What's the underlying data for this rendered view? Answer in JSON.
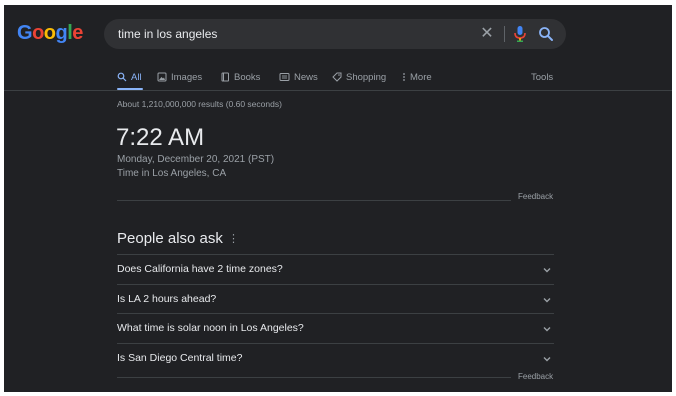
{
  "logo": {
    "text": "Google",
    "letters": [
      {
        "ch": "G",
        "color": "#4285f4"
      },
      {
        "ch": "o",
        "color": "#ea4335"
      },
      {
        "ch": "o",
        "color": "#fbbc05"
      },
      {
        "ch": "g",
        "color": "#4285f4"
      },
      {
        "ch": "l",
        "color": "#34a853"
      },
      {
        "ch": "e",
        "color": "#ea4335"
      }
    ]
  },
  "search": {
    "query": "time in los angeles",
    "clear_icon": "close-icon",
    "mic_icon": "mic-icon",
    "search_icon": "search-icon"
  },
  "tabs": [
    {
      "label": "All",
      "icon": "search-icon",
      "active": true
    },
    {
      "label": "Images",
      "icon": "image-icon",
      "active": false
    },
    {
      "label": "Books",
      "icon": "book-icon",
      "active": false
    },
    {
      "label": "News",
      "icon": "news-icon",
      "active": false
    },
    {
      "label": "Shopping",
      "icon": "tag-icon",
      "active": false
    },
    {
      "label": "More",
      "icon": "more-vert-icon",
      "active": false
    }
  ],
  "tools_label": "Tools",
  "result_stats": "About 1,210,000,000 results (0.60 seconds)",
  "time_card": {
    "time": "7:22 AM",
    "date": "Monday, December 20, 2021 (PST)",
    "location": "Time in Los Angeles, CA",
    "feedback": "Feedback"
  },
  "people_also_ask": {
    "title": "People also ask",
    "questions": [
      "Does California have 2 time zones?",
      "Is LA 2 hours ahead?",
      "What time is solar noon in Los Angeles?",
      "Is San Diego Central time?"
    ],
    "feedback": "Feedback"
  },
  "colors": {
    "background": "#202124",
    "search_box": "#303134",
    "accent": "#8ab4f8",
    "text_primary": "#e8eaed",
    "text_secondary": "#9aa0a6",
    "divider": "#3c4043"
  }
}
